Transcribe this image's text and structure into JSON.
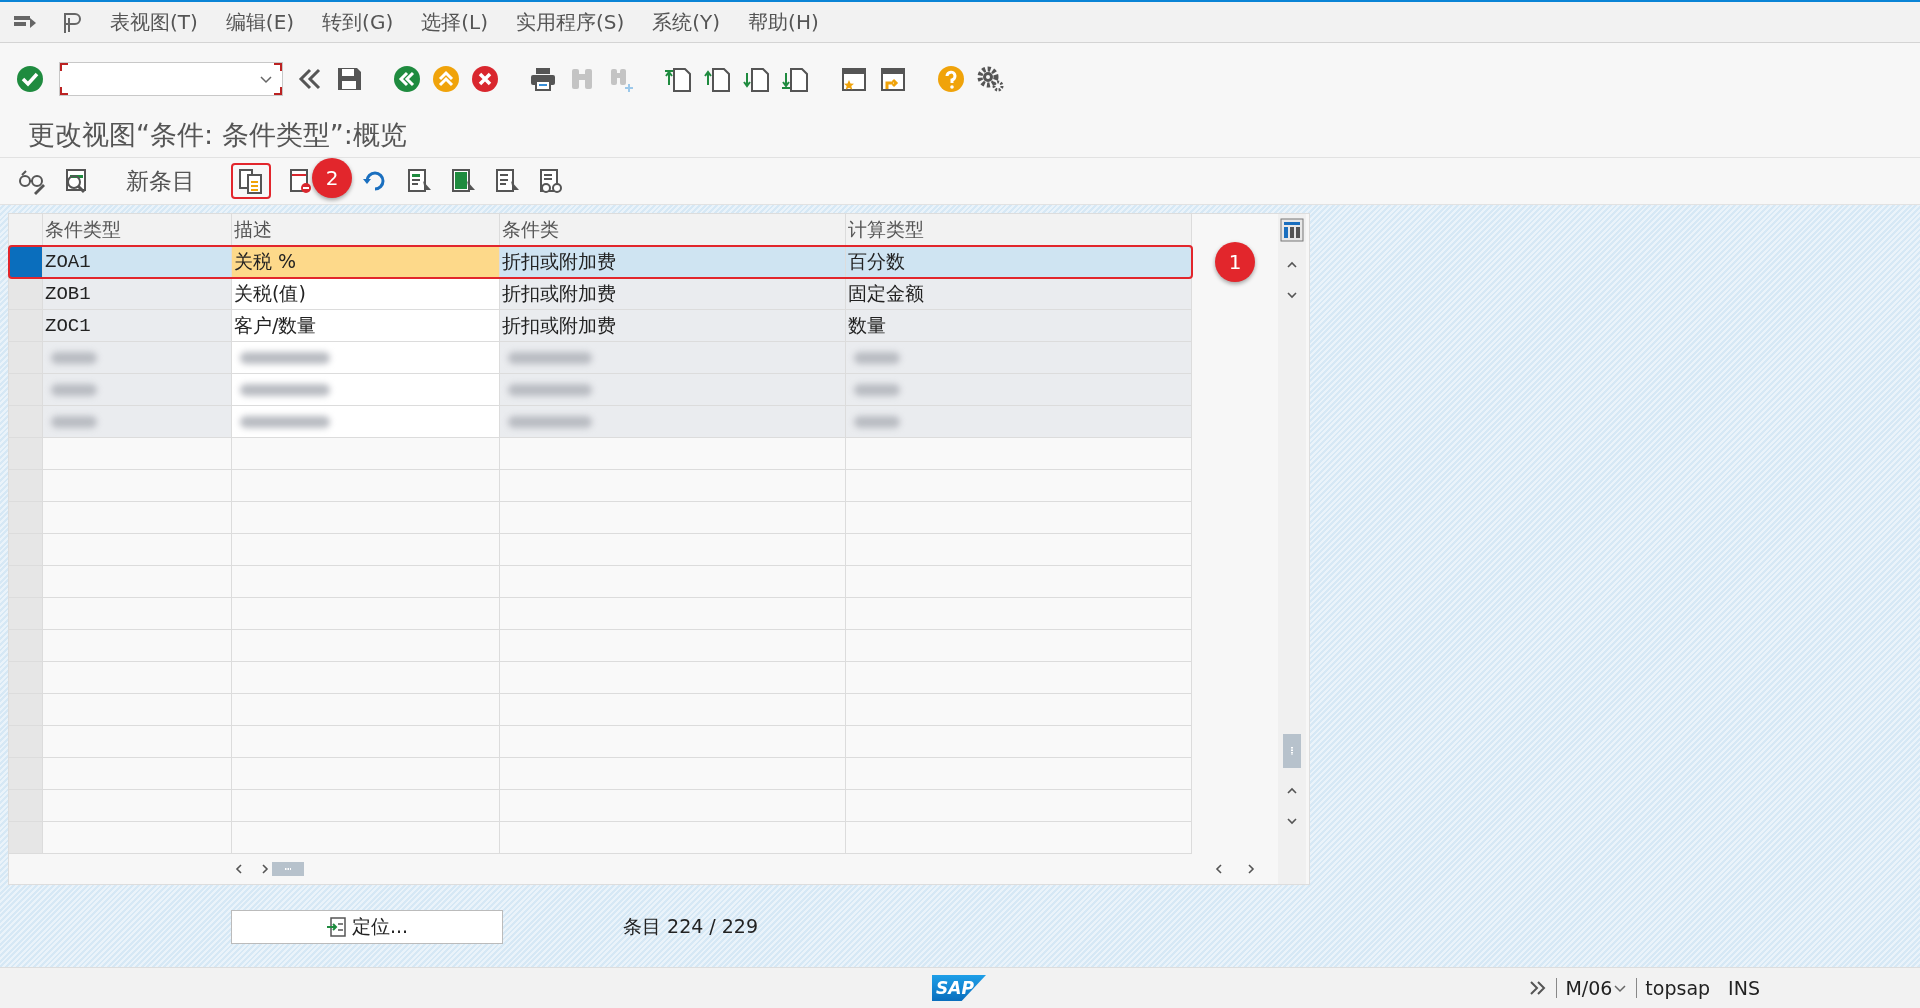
{
  "menu_bar": {
    "items": [
      "表视图(T)",
      "编辑(E)",
      "转到(G)",
      "选择(L)",
      "实用程序(S)",
      "系统(Y)",
      "帮助(H)"
    ]
  },
  "title": "更改视图“条件: 条件类型”:概览",
  "app_toolbar": {
    "new_entries": "新条目",
    "copy_highlighted": true
  },
  "table": {
    "columns": [
      "条件类型",
      "描述",
      "条件类",
      "计算类型"
    ],
    "rows": [
      {
        "kind": "data",
        "cells": [
          "ZOA1",
          "关税 %",
          "折扣或附加费",
          "百分数"
        ],
        "selected": true,
        "highlighted": true,
        "description_focused": true
      },
      {
        "kind": "data",
        "cells": [
          "ZOB1",
          "关税(值)",
          "折扣或附加费",
          "固定金额"
        ],
        "selected": false,
        "highlighted": false,
        "description_focused": false
      },
      {
        "kind": "data",
        "cells": [
          "ZOC1",
          "客户/数量",
          "折扣或附加费",
          "数量"
        ],
        "selected": false,
        "highlighted": false,
        "description_focused": false
      },
      {
        "kind": "blurred"
      },
      {
        "kind": "blurred"
      },
      {
        "kind": "blurred"
      }
    ]
  },
  "locate_button": "定位...",
  "entry_count": "条目 224 / 229",
  "status_bar": {
    "logo": "SAP",
    "session": "M/06",
    "client": "topsap",
    "mode": "INS"
  },
  "annotations": [
    "1",
    "2"
  ]
}
